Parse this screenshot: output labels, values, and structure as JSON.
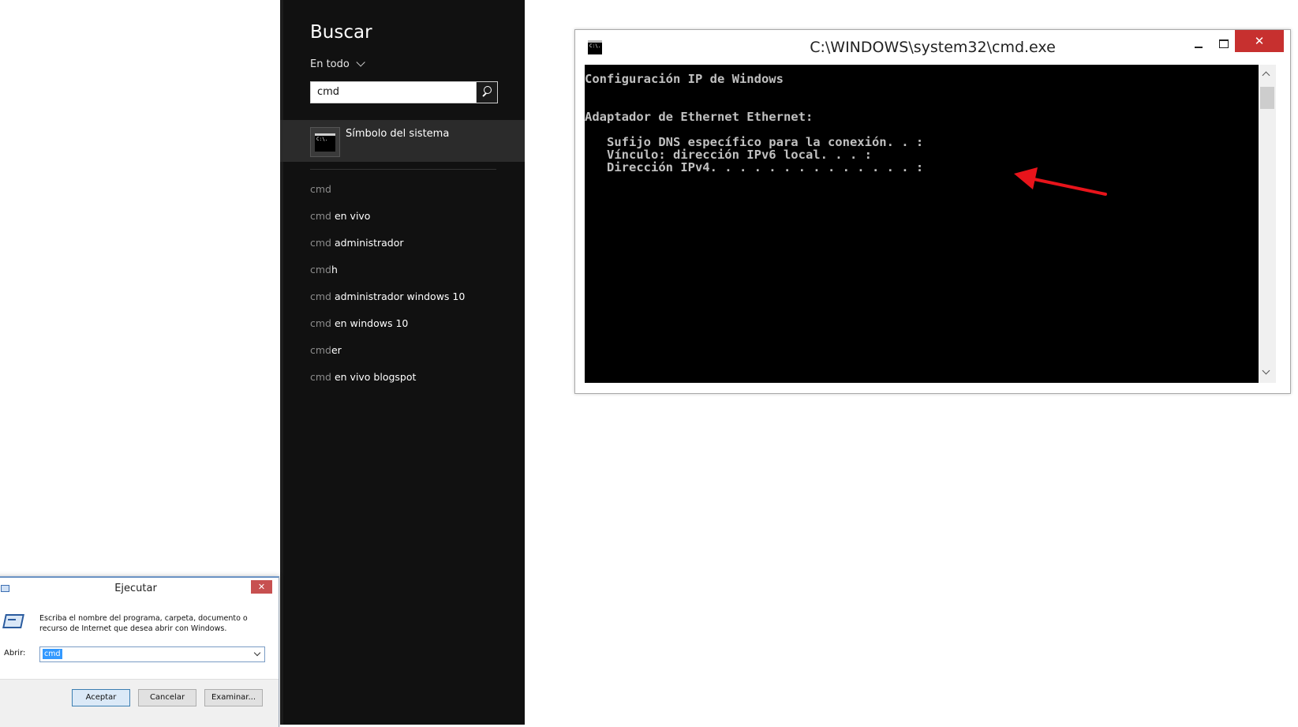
{
  "search_panel": {
    "title": "Buscar",
    "scope": "En todo",
    "query": "cmd",
    "top_result": "Símbolo del sistema",
    "top_result_icon": "C:\\.",
    "suggestions": [
      {
        "match": "cmd",
        "rest": ""
      },
      {
        "match": "cmd",
        "rest": " en vivo"
      },
      {
        "match": "cmd",
        "rest": " administrador"
      },
      {
        "match": "cmd",
        "rest": "h"
      },
      {
        "match": "cmd",
        "rest": " administrador windows 10"
      },
      {
        "match": "cmd",
        "rest": " en windows 10"
      },
      {
        "match": "cmd",
        "rest": "er"
      },
      {
        "match": "cmd",
        "rest": " en vivo blogspot"
      }
    ]
  },
  "run_dialog": {
    "title": "Ejecutar",
    "close": "✕",
    "description": "Escriba el nombre del programa, carpeta, documento o recurso de Internet que desea abrir con Windows.",
    "open_label": "Abrir:",
    "open_value": "cmd",
    "buttons": {
      "ok": "Aceptar",
      "cancel": "Cancelar",
      "browse": "Examinar..."
    }
  },
  "cmd_window": {
    "title": "C:\\WINDOWS\\system32\\cmd.exe",
    "icon_text": "C:\\.",
    "close": "✕",
    "console_lines": [
      "Configuración IP de Windows",
      "",
      "",
      "Adaptador de Ethernet Ethernet:",
      "",
      "   Sufijo DNS específico para la conexión. . :",
      "   Vínculo: dirección IPv6 local. . . :",
      "   Dirección IPv4. . . . . . . . . . . . . . :"
    ]
  },
  "annotation": {
    "color": "#e8141b",
    "icon": "red-arrow-pointer"
  }
}
